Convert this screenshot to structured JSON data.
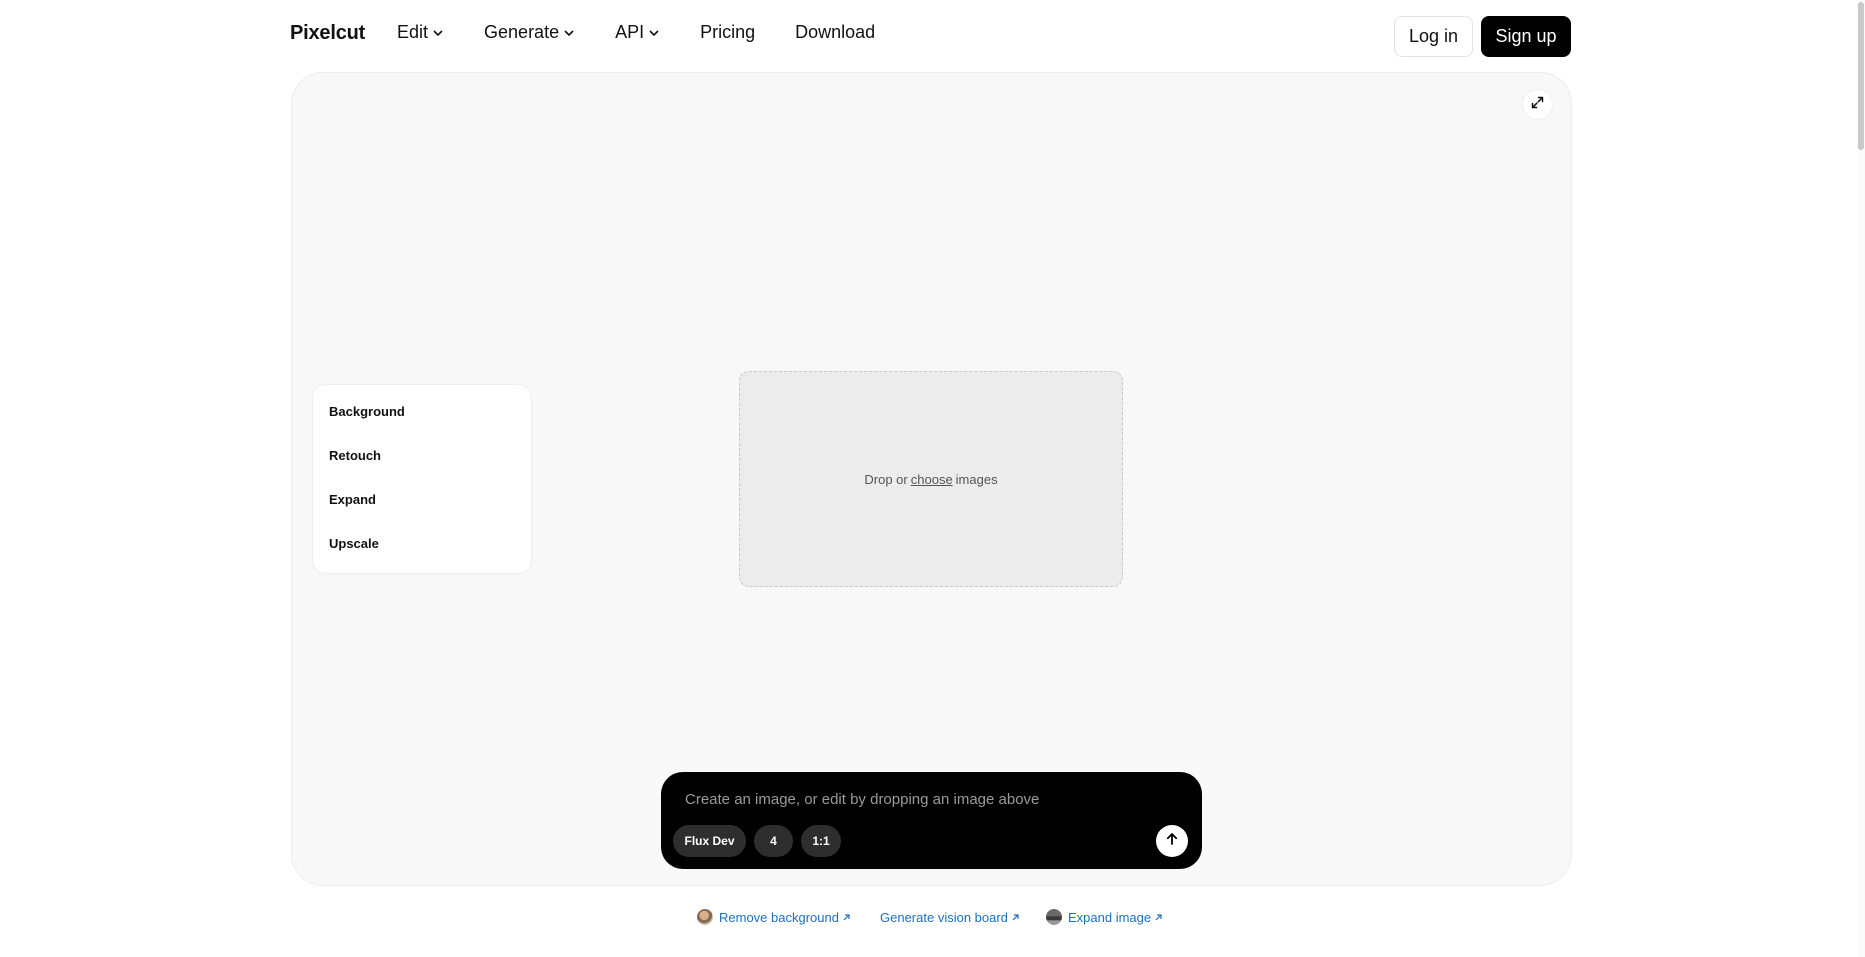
{
  "brand": {
    "logo": "Pixelcut"
  },
  "nav": {
    "items": [
      {
        "label": "Edit",
        "has_dropdown": true
      },
      {
        "label": "Generate",
        "has_dropdown": true
      },
      {
        "label": "API",
        "has_dropdown": true
      },
      {
        "label": "Pricing",
        "has_dropdown": false
      },
      {
        "label": "Download",
        "has_dropdown": false
      }
    ],
    "login_label": "Log in",
    "signup_label": "Sign up"
  },
  "canvas": {
    "expand_icon": "expand-arrows-icon",
    "tools": [
      "Background",
      "Retouch",
      "Expand",
      "Upscale"
    ],
    "drop_zone": {
      "prefix": "Drop or",
      "link": "choose",
      "suffix": "images"
    }
  },
  "prompt": {
    "placeholder": "Create an image, or edit by dropping an image above",
    "value": "",
    "model": "Flux Dev",
    "count": "4",
    "ratio": "1:1",
    "send_icon": "arrow-up-icon"
  },
  "footer_links": [
    {
      "label": "Remove background",
      "has_avatar": true
    },
    {
      "label": "Generate vision board",
      "has_avatar": false
    },
    {
      "label": "Expand image",
      "has_avatar": true
    }
  ],
  "colors": {
    "link": "#1e6fc0",
    "primary_button": "#000000",
    "canvas_bg": "#f8f8f8",
    "prompt_bg": "#000000"
  }
}
